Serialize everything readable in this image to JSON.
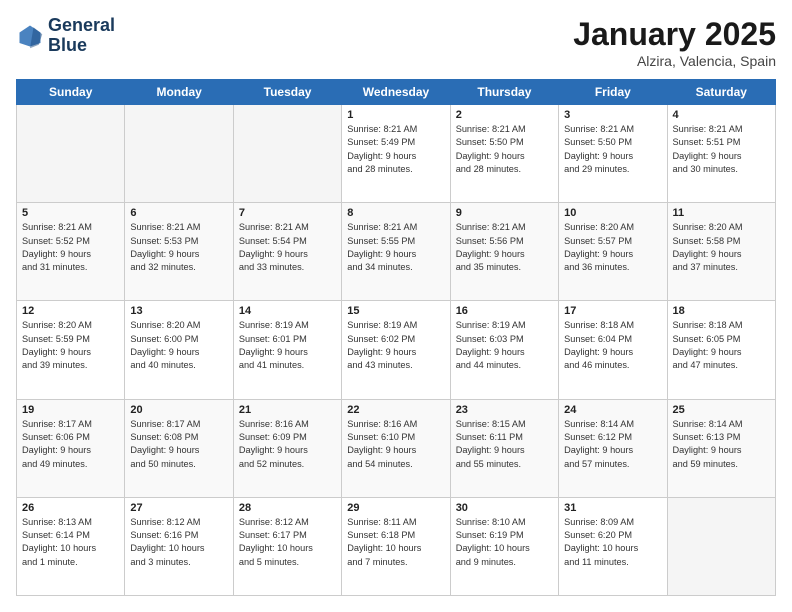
{
  "header": {
    "logo_line1": "General",
    "logo_line2": "Blue",
    "month": "January 2025",
    "location": "Alzira, Valencia, Spain"
  },
  "weekdays": [
    "Sunday",
    "Monday",
    "Tuesday",
    "Wednesday",
    "Thursday",
    "Friday",
    "Saturday"
  ],
  "weeks": [
    [
      {
        "day": "",
        "info": ""
      },
      {
        "day": "",
        "info": ""
      },
      {
        "day": "",
        "info": ""
      },
      {
        "day": "1",
        "info": "Sunrise: 8:21 AM\nSunset: 5:49 PM\nDaylight: 9 hours\nand 28 minutes."
      },
      {
        "day": "2",
        "info": "Sunrise: 8:21 AM\nSunset: 5:50 PM\nDaylight: 9 hours\nand 28 minutes."
      },
      {
        "day": "3",
        "info": "Sunrise: 8:21 AM\nSunset: 5:50 PM\nDaylight: 9 hours\nand 29 minutes."
      },
      {
        "day": "4",
        "info": "Sunrise: 8:21 AM\nSunset: 5:51 PM\nDaylight: 9 hours\nand 30 minutes."
      }
    ],
    [
      {
        "day": "5",
        "info": "Sunrise: 8:21 AM\nSunset: 5:52 PM\nDaylight: 9 hours\nand 31 minutes."
      },
      {
        "day": "6",
        "info": "Sunrise: 8:21 AM\nSunset: 5:53 PM\nDaylight: 9 hours\nand 32 minutes."
      },
      {
        "day": "7",
        "info": "Sunrise: 8:21 AM\nSunset: 5:54 PM\nDaylight: 9 hours\nand 33 minutes."
      },
      {
        "day": "8",
        "info": "Sunrise: 8:21 AM\nSunset: 5:55 PM\nDaylight: 9 hours\nand 34 minutes."
      },
      {
        "day": "9",
        "info": "Sunrise: 8:21 AM\nSunset: 5:56 PM\nDaylight: 9 hours\nand 35 minutes."
      },
      {
        "day": "10",
        "info": "Sunrise: 8:20 AM\nSunset: 5:57 PM\nDaylight: 9 hours\nand 36 minutes."
      },
      {
        "day": "11",
        "info": "Sunrise: 8:20 AM\nSunset: 5:58 PM\nDaylight: 9 hours\nand 37 minutes."
      }
    ],
    [
      {
        "day": "12",
        "info": "Sunrise: 8:20 AM\nSunset: 5:59 PM\nDaylight: 9 hours\nand 39 minutes."
      },
      {
        "day": "13",
        "info": "Sunrise: 8:20 AM\nSunset: 6:00 PM\nDaylight: 9 hours\nand 40 minutes."
      },
      {
        "day": "14",
        "info": "Sunrise: 8:19 AM\nSunset: 6:01 PM\nDaylight: 9 hours\nand 41 minutes."
      },
      {
        "day": "15",
        "info": "Sunrise: 8:19 AM\nSunset: 6:02 PM\nDaylight: 9 hours\nand 43 minutes."
      },
      {
        "day": "16",
        "info": "Sunrise: 8:19 AM\nSunset: 6:03 PM\nDaylight: 9 hours\nand 44 minutes."
      },
      {
        "day": "17",
        "info": "Sunrise: 8:18 AM\nSunset: 6:04 PM\nDaylight: 9 hours\nand 46 minutes."
      },
      {
        "day": "18",
        "info": "Sunrise: 8:18 AM\nSunset: 6:05 PM\nDaylight: 9 hours\nand 47 minutes."
      }
    ],
    [
      {
        "day": "19",
        "info": "Sunrise: 8:17 AM\nSunset: 6:06 PM\nDaylight: 9 hours\nand 49 minutes."
      },
      {
        "day": "20",
        "info": "Sunrise: 8:17 AM\nSunset: 6:08 PM\nDaylight: 9 hours\nand 50 minutes."
      },
      {
        "day": "21",
        "info": "Sunrise: 8:16 AM\nSunset: 6:09 PM\nDaylight: 9 hours\nand 52 minutes."
      },
      {
        "day": "22",
        "info": "Sunrise: 8:16 AM\nSunset: 6:10 PM\nDaylight: 9 hours\nand 54 minutes."
      },
      {
        "day": "23",
        "info": "Sunrise: 8:15 AM\nSunset: 6:11 PM\nDaylight: 9 hours\nand 55 minutes."
      },
      {
        "day": "24",
        "info": "Sunrise: 8:14 AM\nSunset: 6:12 PM\nDaylight: 9 hours\nand 57 minutes."
      },
      {
        "day": "25",
        "info": "Sunrise: 8:14 AM\nSunset: 6:13 PM\nDaylight: 9 hours\nand 59 minutes."
      }
    ],
    [
      {
        "day": "26",
        "info": "Sunrise: 8:13 AM\nSunset: 6:14 PM\nDaylight: 10 hours\nand 1 minute."
      },
      {
        "day": "27",
        "info": "Sunrise: 8:12 AM\nSunset: 6:16 PM\nDaylight: 10 hours\nand 3 minutes."
      },
      {
        "day": "28",
        "info": "Sunrise: 8:12 AM\nSunset: 6:17 PM\nDaylight: 10 hours\nand 5 minutes."
      },
      {
        "day": "29",
        "info": "Sunrise: 8:11 AM\nSunset: 6:18 PM\nDaylight: 10 hours\nand 7 minutes."
      },
      {
        "day": "30",
        "info": "Sunrise: 8:10 AM\nSunset: 6:19 PM\nDaylight: 10 hours\nand 9 minutes."
      },
      {
        "day": "31",
        "info": "Sunrise: 8:09 AM\nSunset: 6:20 PM\nDaylight: 10 hours\nand 11 minutes."
      },
      {
        "day": "",
        "info": ""
      }
    ]
  ]
}
